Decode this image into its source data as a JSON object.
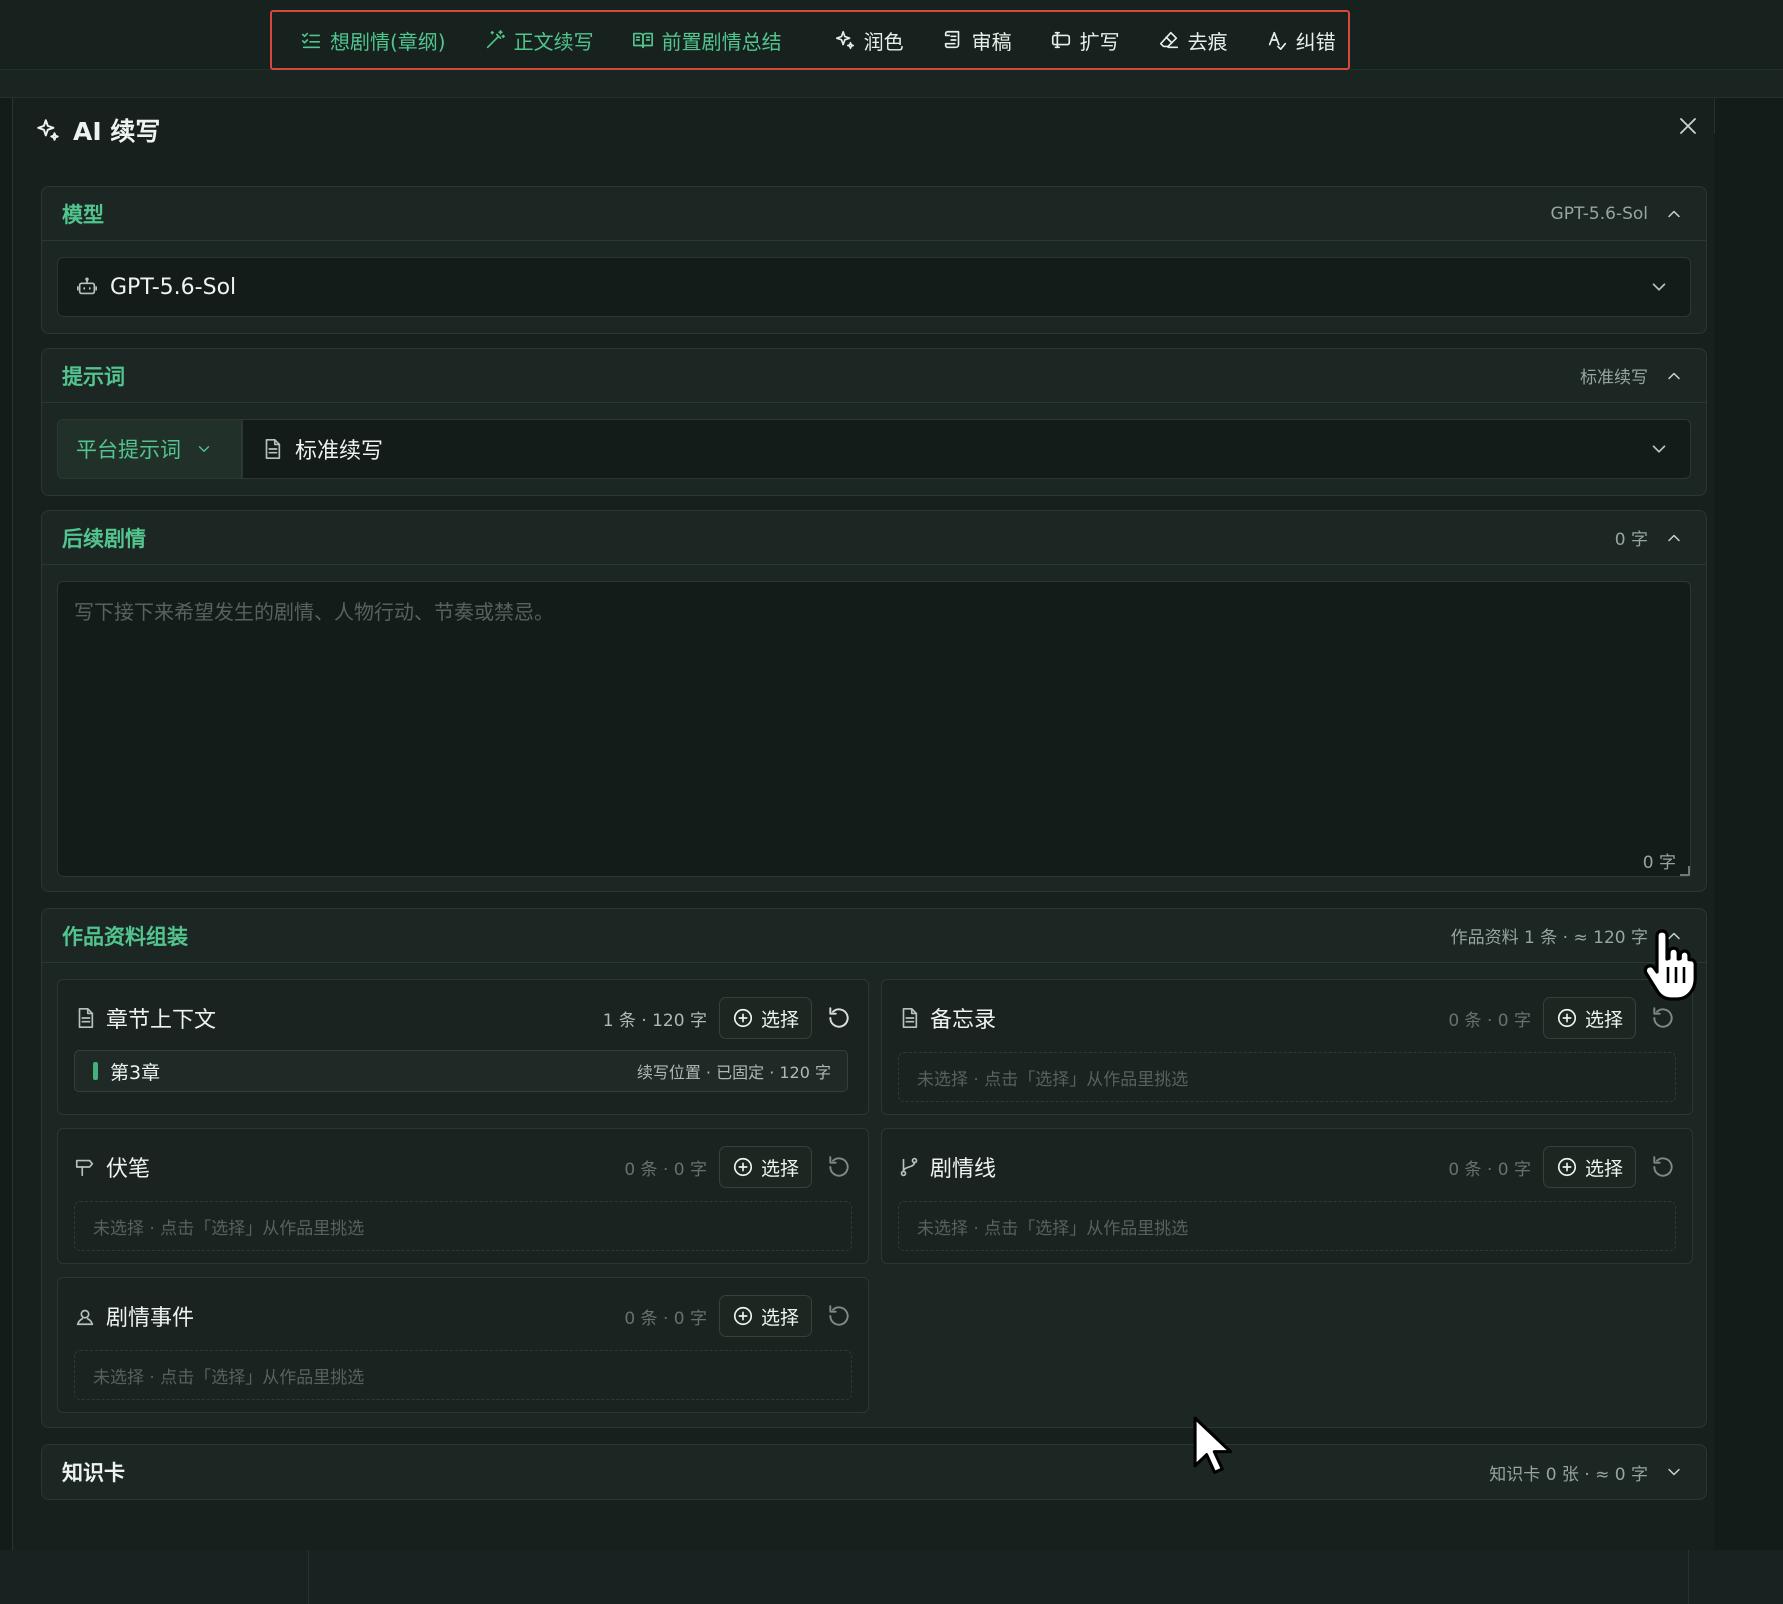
{
  "toolbar": {
    "items": [
      {
        "label": "想剧情(章纲)",
        "icon": "checklist-icon",
        "tone": "green"
      },
      {
        "label": "正文续写",
        "icon": "magic-wand-icon",
        "tone": "green"
      },
      {
        "label": "前置剧情总结",
        "icon": "book-open-icon",
        "tone": "green"
      },
      {
        "label": "润色",
        "icon": "sparkles-icon",
        "tone": "white"
      },
      {
        "label": "审稿",
        "icon": "scroll-icon",
        "tone": "white"
      },
      {
        "label": "扩写",
        "icon": "expand-icon",
        "tone": "white"
      },
      {
        "label": "去痕",
        "icon": "eraser-icon",
        "tone": "white"
      },
      {
        "label": "纠错",
        "icon": "spellcheck-icon",
        "tone": "white"
      }
    ]
  },
  "dialog": {
    "title": "AI 续写"
  },
  "model": {
    "title": "模型",
    "summary": "GPT-5.6-Sol",
    "selected": "GPT-5.6-Sol"
  },
  "prompt": {
    "title": "提示词",
    "summary": "标准续写",
    "source": "平台提示词",
    "selected": "标准续写"
  },
  "followup": {
    "title": "后续剧情",
    "summary": "0 字",
    "placeholder": "写下接下来希望发生的剧情、人物行动、节奏或禁忌。",
    "value": "",
    "count": "0 字"
  },
  "assembly": {
    "title": "作品资料组装",
    "summary": "作品资料 1 条 · ≈ 120 字",
    "select_label": "选择",
    "empty_hint": "未选择 · 点击「选择」从作品里挑选",
    "cards": {
      "chapter": {
        "title": "章节上下文",
        "count": "1 条 · 120 字",
        "chapter_name": "第3章",
        "chapter_meta": "续写位置 · 已固定 · 120 字"
      },
      "memo": {
        "title": "备忘录",
        "count": "0 条 · 0 字"
      },
      "foreshadow": {
        "title": "伏笔",
        "count": "0 条 · 0 字"
      },
      "plotline": {
        "title": "剧情线",
        "count": "0 条 · 0 字"
      },
      "events": {
        "title": "剧情事件",
        "count": "0 条 · 0 字"
      }
    }
  },
  "knowledge": {
    "title": "知识卡",
    "summary": "知识卡 0 张 · ≈ 0 字"
  },
  "colors": {
    "accent": "#52c48f",
    "background": "#141c19",
    "highlight_border": "#d6483c"
  }
}
